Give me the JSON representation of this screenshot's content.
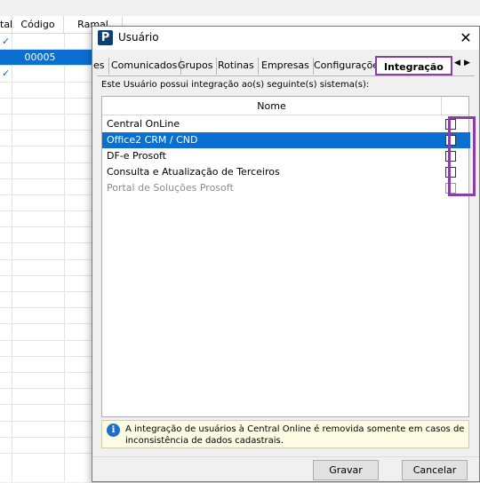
{
  "background": {
    "columns": [
      "tal",
      "Código",
      "Ramal"
    ],
    "selected_code": "00005"
  },
  "dialog": {
    "title": "Usuário",
    "close_glyph": "✕",
    "tabs": [
      "es",
      "Comunicados",
      "Grupos",
      "Rotinas",
      "Empresas",
      "Configurações"
    ],
    "active_tab": "Integração",
    "tab_prev": "◀",
    "tab_next": "▶",
    "panel_label": "Este Usuário possui integração ao(s) seguinte(s) sistema(s):",
    "list": {
      "header": "Nome",
      "rows": [
        {
          "name": "Central OnLine",
          "checked": false,
          "selected": false,
          "enabled": true
        },
        {
          "name": "Office2 CRM / CND",
          "checked": false,
          "selected": true,
          "enabled": true
        },
        {
          "name": "DF-e Prosoft",
          "checked": false,
          "selected": false,
          "enabled": true
        },
        {
          "name": "Consulta e Atualização de Terceiros",
          "checked": false,
          "selected": false,
          "enabled": true
        },
        {
          "name": "Portal de Soluções Prosoft",
          "checked": false,
          "selected": false,
          "enabled": false
        }
      ]
    },
    "info": {
      "icon": "info-icon",
      "line1": "A integração de usuários à Central Online é removida somente em casos de",
      "line2": "inconsistência de dados cadastrais."
    },
    "buttons": {
      "save": "Gravar",
      "cancel": "Cancelar"
    }
  },
  "colors": {
    "selection": "#0b6fd1",
    "highlight": "#8a3fa8",
    "info_bg": "#fdfbe3"
  }
}
